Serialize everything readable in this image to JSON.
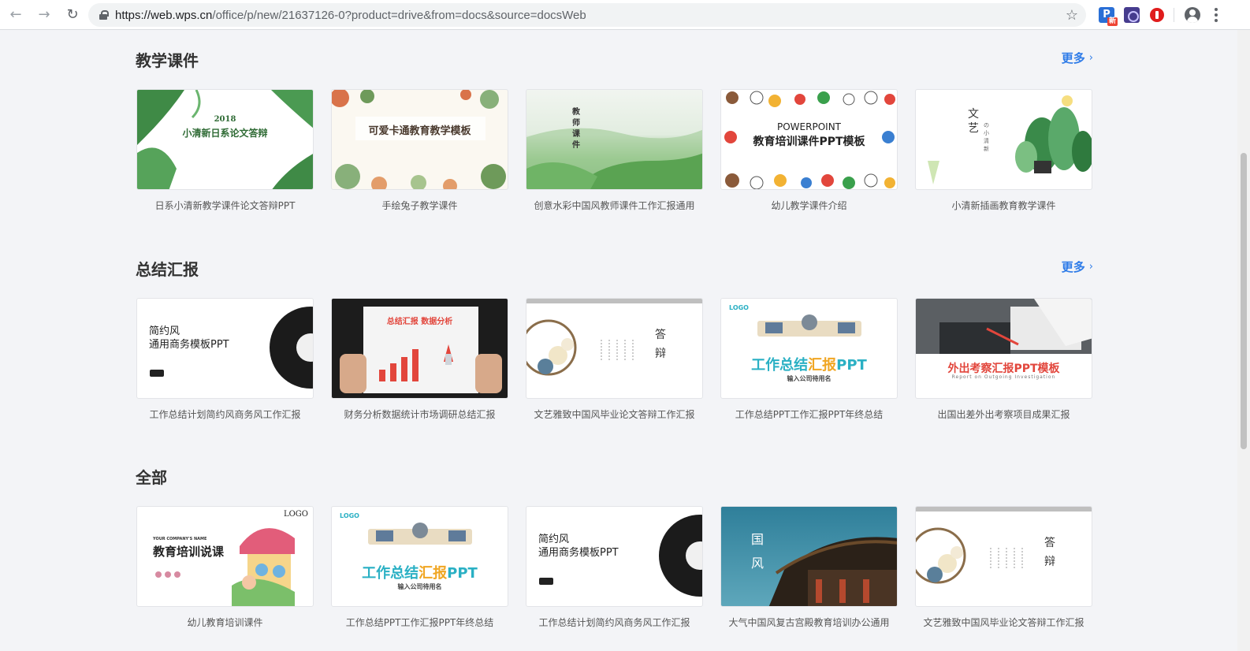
{
  "browser": {
    "url_host": "https://web.wps.cn",
    "url_path": "/office/p/new/21637126-0?product=drive&from=docs&source=docsWeb",
    "ext1_letter": "P",
    "ext1_badge": "新"
  },
  "colors": {
    "accent": "#2f7ce8",
    "page_bg": "#f3f4f7"
  },
  "sections": [
    {
      "title": "教学课件",
      "more": "更多",
      "cards": [
        {
          "label": "日系小清新教学课件论文答辩PPT",
          "line1": "2018",
          "line2": "小清新日系论文答辩"
        },
        {
          "label": "手绘兔子教学课件",
          "line1": "可爱卡通教育教学模板"
        },
        {
          "label": "创意水彩中国风教师课件工作汇报通用",
          "line1": "教师课件"
        },
        {
          "label": "幼儿教学课件介绍",
          "line1": "POWERPOINT",
          "line2": "教育培训课件PPT模板"
        },
        {
          "label": "小清新插画教育教学课件",
          "line1": "文艺",
          "line2": "の小清新"
        }
      ]
    },
    {
      "title": "总结汇报",
      "more": "更多",
      "cards": [
        {
          "label": "工作总结计划简约风商务风工作汇报",
          "line1": "简约风",
          "line2": "通用商务模板PPT"
        },
        {
          "label": "财务分析数据统计市场调研总结汇报",
          "line1": "总结汇报  数据分析"
        },
        {
          "label": "文艺雅致中国风毕业论文答辩工作汇报",
          "line1": "答辩"
        },
        {
          "label": "工作总结PPT工作汇报PPT年终总结",
          "logo": "LOGO",
          "line1": "工作总结",
          "line1b": "汇报",
          "line1c": "PPT",
          "line2": "输入公司待用名"
        },
        {
          "label": "出国出差外出考察项目成果汇报",
          "line1": "外出考察汇报PPT模板",
          "line2": "Report on Outgoing Investigation"
        }
      ]
    },
    {
      "title": "全部",
      "cards": [
        {
          "label": "幼儿教育培训课件",
          "line1": "教育培训说课",
          "line2": "YOUR COMPANY'S NAME",
          "logo": "LOGO"
        },
        {
          "label": "工作总结PPT工作汇报PPT年终总结",
          "logo": "LOGO",
          "line1": "工作总结",
          "line1b": "汇报",
          "line1c": "PPT",
          "line2": "输入公司待用名"
        },
        {
          "label": "工作总结计划简约风商务风工作汇报",
          "line1": "简约风",
          "line2": "通用商务模板PPT"
        },
        {
          "label": "大气中国风复古宫殿教育培训办公通用",
          "line1": "国",
          "line2": "风"
        },
        {
          "label": "文艺雅致中国风毕业论文答辩工作汇报",
          "line1": "答辩"
        }
      ]
    }
  ]
}
